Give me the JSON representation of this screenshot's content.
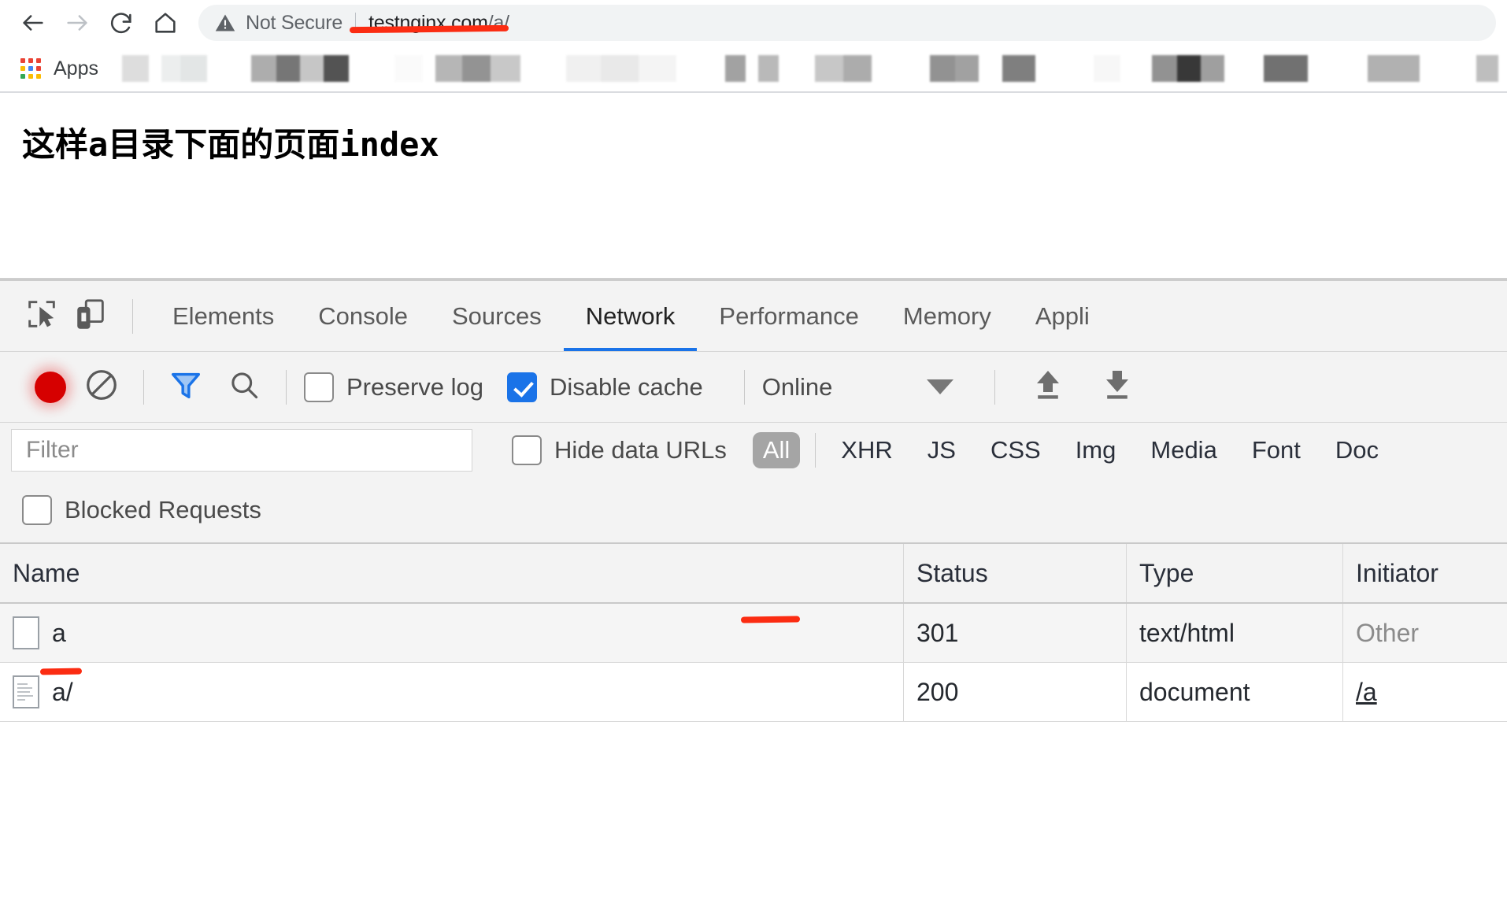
{
  "browser": {
    "nav": {
      "back_icon": "arrow-left-icon",
      "forward_icon": "arrow-right-icon",
      "reload_icon": "reload-icon",
      "home_icon": "home-icon"
    },
    "omnibox": {
      "security_icon": "warning-triangle-icon",
      "security_label": "Not Secure",
      "url_host": "testnginx.com",
      "url_path": "/a/"
    },
    "bookmarks": {
      "apps_label": "Apps",
      "apps_icon": "apps-grid-icon"
    }
  },
  "page": {
    "heading": "这样a目录下面的页面index"
  },
  "devtools": {
    "inspect_icon": "inspect-cursor-icon",
    "device_icon": "device-toolbar-icon",
    "tabs": [
      {
        "label": "Elements",
        "active": false
      },
      {
        "label": "Console",
        "active": false
      },
      {
        "label": "Sources",
        "active": false
      },
      {
        "label": "Network",
        "active": true
      },
      {
        "label": "Performance",
        "active": false
      },
      {
        "label": "Memory",
        "active": false
      },
      {
        "label": "Appli",
        "active": false
      }
    ],
    "toolbar": {
      "record_icon": "record-dot-icon",
      "clear_icon": "clear-no-entry-icon",
      "filter_icon": "funnel-filter-icon",
      "search_icon": "search-icon",
      "preserve_log_label": "Preserve log",
      "preserve_log_checked": false,
      "disable_cache_label": "Disable cache",
      "disable_cache_checked": true,
      "throttling_value": "Online",
      "throttling_caret_icon": "chevron-down-icon",
      "import_icon": "upload-arrow-icon",
      "export_icon": "download-arrow-icon"
    },
    "filterbar": {
      "filter_placeholder": "Filter",
      "filter_value": "",
      "hide_data_urls_label": "Hide data URLs",
      "hide_data_urls_checked": false,
      "types": [
        {
          "label": "All",
          "selected": true
        },
        {
          "label": "XHR",
          "selected": false
        },
        {
          "label": "JS",
          "selected": false
        },
        {
          "label": "CSS",
          "selected": false
        },
        {
          "label": "Img",
          "selected": false
        },
        {
          "label": "Media",
          "selected": false
        },
        {
          "label": "Font",
          "selected": false
        },
        {
          "label": "Doc",
          "selected": false
        }
      ],
      "blocked_requests_label": "Blocked Requests",
      "blocked_requests_checked": false
    },
    "table": {
      "columns": [
        "Name",
        "Status",
        "Type",
        "Initiator"
      ],
      "rows": [
        {
          "icon": "blank-document-icon",
          "name": "a",
          "status": "301",
          "type": "text/html",
          "initiator": "Other",
          "initiator_style": "muted"
        },
        {
          "icon": "document-icon",
          "name": "a/",
          "status": "200",
          "type": "document",
          "initiator": "/a",
          "initiator_style": "link"
        }
      ]
    }
  },
  "annotations": {
    "accent_color": "#fb2c12",
    "marks": [
      "url-underline",
      "status-301-underline",
      "name-aslash-underline"
    ]
  },
  "colors": {
    "active_tab_underline": "#1a73e8",
    "checkbox_checked": "#1a73e8",
    "record_active": "#d60000",
    "filter_active": "#1a73e8"
  }
}
